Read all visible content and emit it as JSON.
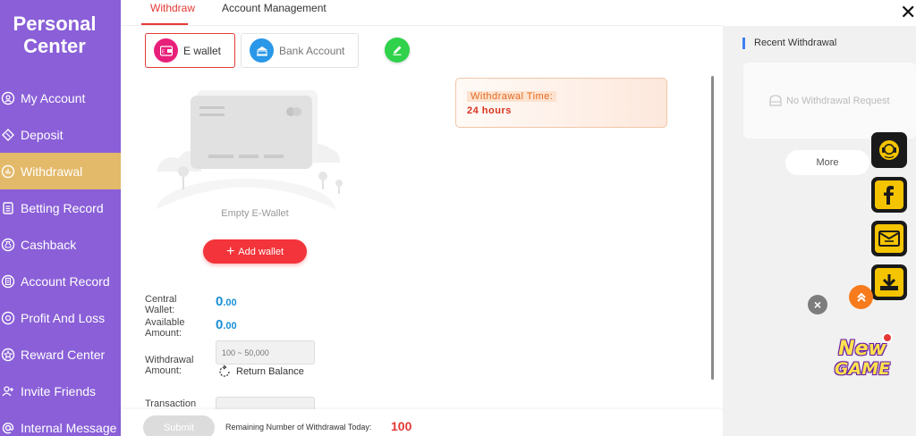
{
  "sidebar": {
    "title_line1": "Personal",
    "title_line2": "Center",
    "items": [
      {
        "label": "My Account",
        "icon": "user-circle-icon"
      },
      {
        "label": "Deposit",
        "icon": "ticket-icon"
      },
      {
        "label": "Withdrawal",
        "icon": "chart-circle-icon"
      },
      {
        "label": "Betting Record",
        "icon": "document-list-icon"
      },
      {
        "label": "Cashback",
        "icon": "money-bag-icon"
      },
      {
        "label": "Account Record",
        "icon": "record-icon"
      },
      {
        "label": "Profit And Loss",
        "icon": "dollar-circle-icon"
      },
      {
        "label": "Reward Center",
        "icon": "star-icon"
      },
      {
        "label": "Invite Friends",
        "icon": "add-user-icon"
      },
      {
        "label": "Internal Message",
        "icon": "at-icon"
      }
    ],
    "active_item": "Withdrawal",
    "bg_color": "#8a5fd8",
    "active_color": "#e3b96a"
  },
  "tabs": [
    {
      "label": "Withdraw",
      "active": true
    },
    {
      "label": "Account Management",
      "active": false
    }
  ],
  "methods": [
    {
      "label": "E wallet",
      "active": true,
      "icon": "e-wallet-icon",
      "icon_color": "#e8207a"
    },
    {
      "label": "Bank Account",
      "active": false,
      "icon": "bank-icon",
      "icon_color": "#2a97e8"
    }
  ],
  "wallet": {
    "empty_label": "Empty E-Wallet",
    "add_button": "Add wallet"
  },
  "withdrawal_time": {
    "label": "Withdrawal Time:",
    "value": "24 hours"
  },
  "form": {
    "central_wallet_label": "Central Wallet:",
    "central_wallet_value_int": "0",
    "central_wallet_value_dec": ".00",
    "available_label": "Available Amount:",
    "available_value_int": "0",
    "available_value_dec": ".00",
    "withdrawal_amount_label": "Withdrawal Amount:",
    "withdrawal_amount_placeholder": "100 ~ 50,000",
    "return_balance": "Return Balance",
    "transaction_label": "Transaction"
  },
  "bottom": {
    "submit": "Submit",
    "remaining_label": "Remaining Number of Withdrawal Today:",
    "remaining_count": "100"
  },
  "recent": {
    "title": "Recent Withdrawal",
    "empty": "No Withdrawal Request",
    "more": "More"
  },
  "floating": {
    "buttons": [
      "customer-service-icon",
      "facebook-icon",
      "message-icon",
      "download-icon"
    ],
    "new_game_line1": "New",
    "new_game_line2": "GAME"
  },
  "colors": {
    "accent_red": "#e53935",
    "value_blue": "#1a8fd6",
    "edit_green": "#2fd24a"
  }
}
